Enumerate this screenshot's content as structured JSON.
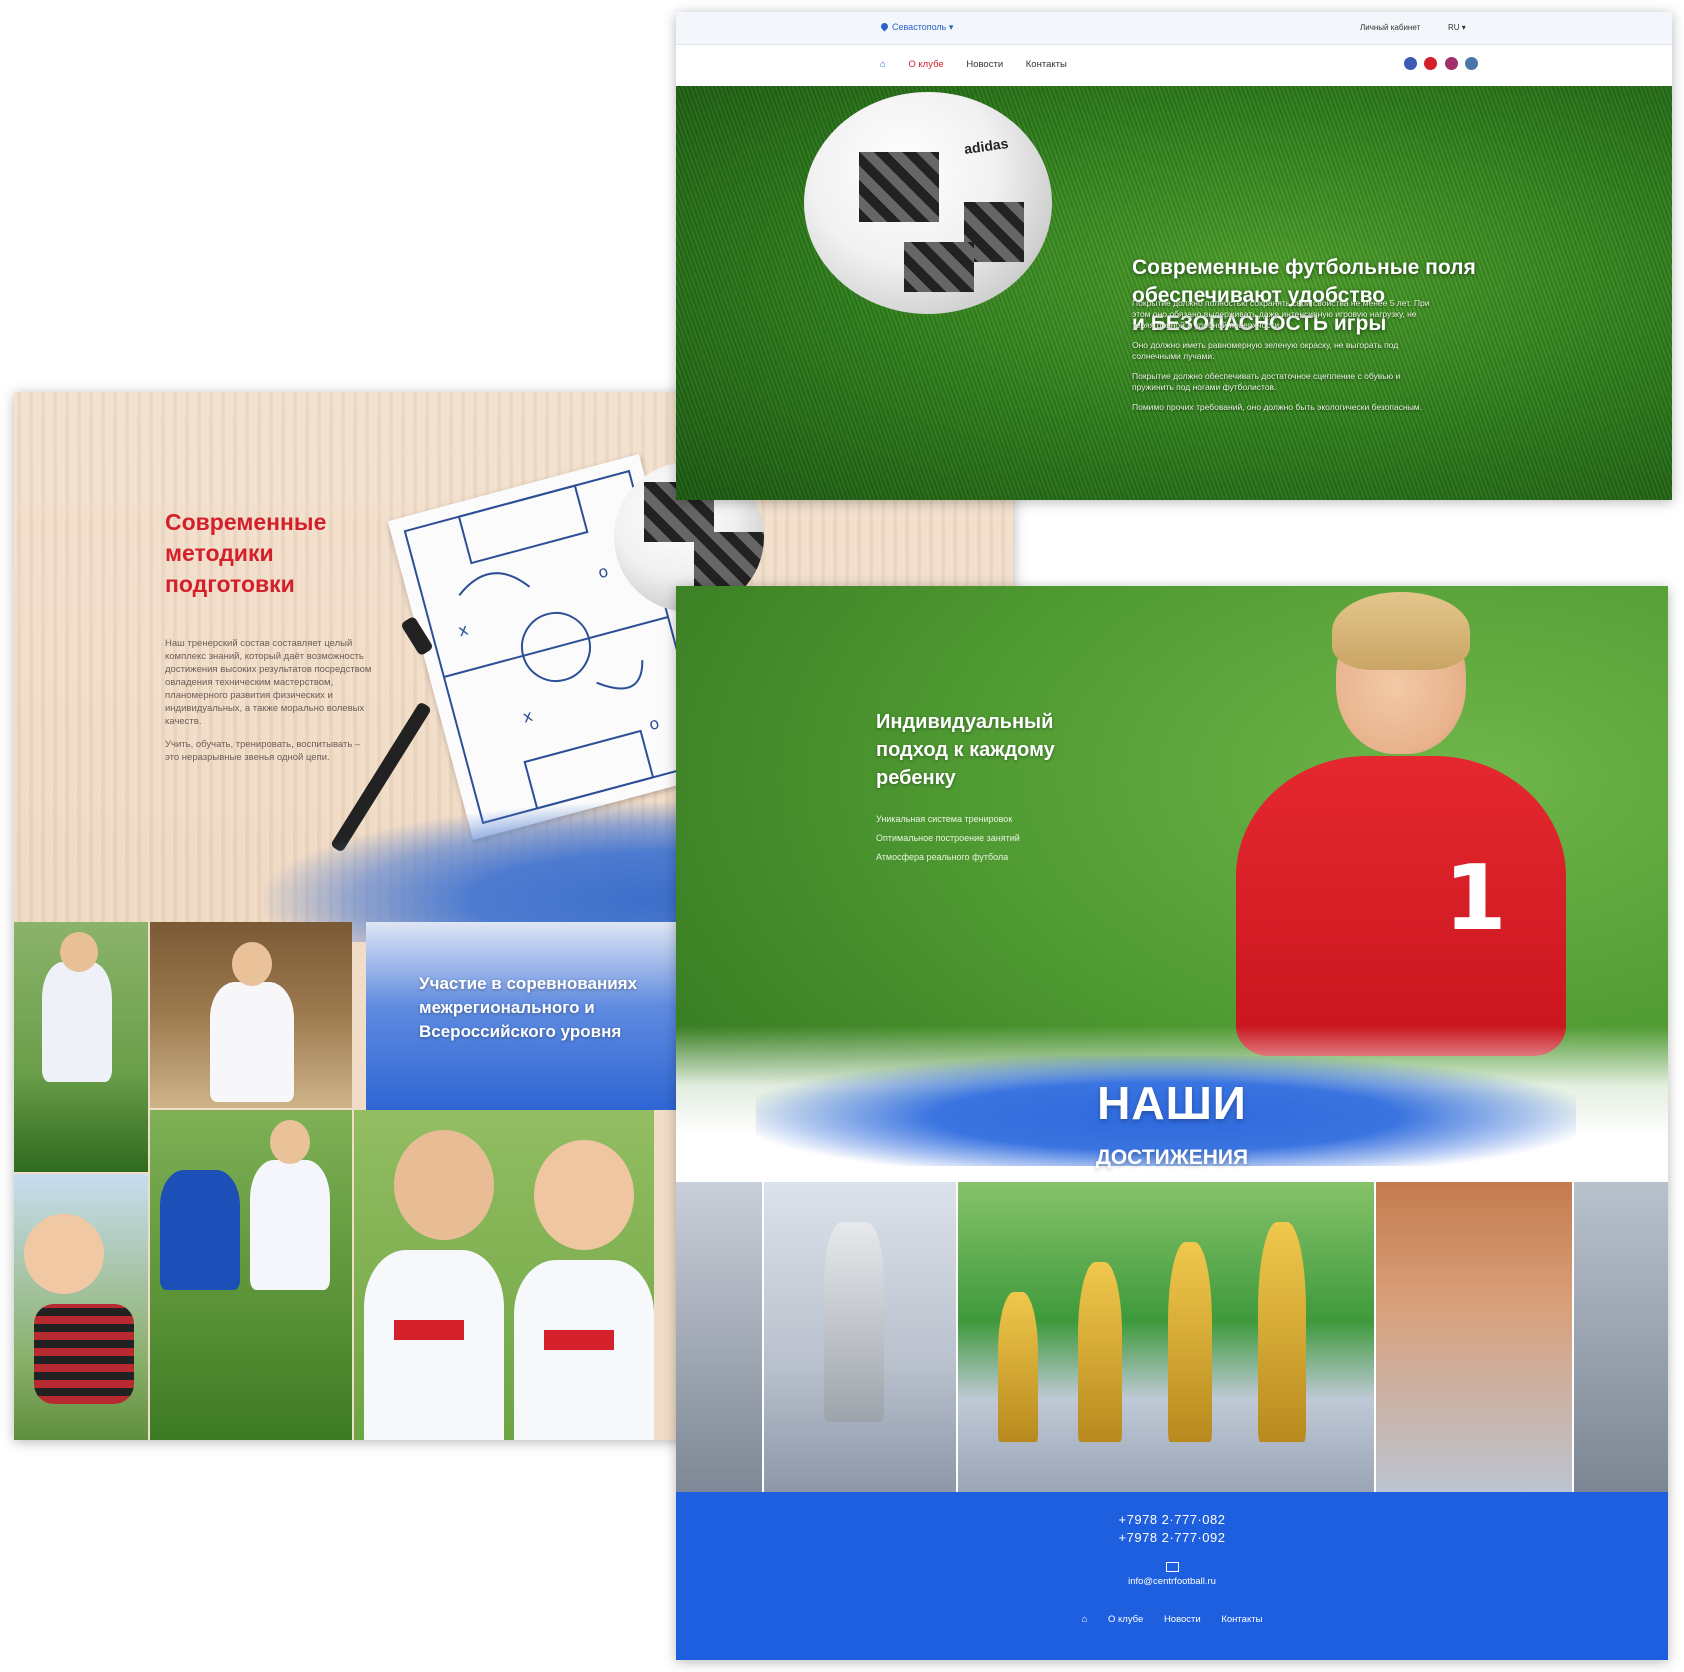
{
  "header": {
    "city": "Севастополь",
    "cabinet": "Личный кабинет",
    "lang": "RU",
    "nav": [
      "О клубе",
      "Новости",
      "Контакты"
    ],
    "social_icons": [
      "facebook-icon",
      "youtube-icon",
      "instagram-icon",
      "vk-icon"
    ]
  },
  "hero": {
    "title_lines": [
      "Современные футбольные поля",
      "обеспечивают  удобство",
      "и БЕЗОПАСНОСТЬ игры"
    ],
    "paragraphs": [
      "Покрытие должно полностью сохранять свои свойства не менее 5 лет. При этом оно обязано выдерживать даже интенсивную игровую нагрузку, не теряя ровной и удобной поверхности.",
      "Оно должно иметь равномерную зеленую окраску, не выгорать под солнечными лучами.",
      "Покрытие должно обеспечивать достаточное сцепление с обувью и пружинить под ногами футболистов.",
      "Помимо прочих требований, оно должно быть экологически безопасным."
    ],
    "ball_brand": "adidas"
  },
  "methods": {
    "title_lines": [
      "Современные",
      "методики",
      "подготовки"
    ],
    "paragraphs": [
      "Наш тренерский состав составляет целый комплекс знаний, который даёт возможность достижения высоких результатов посредством овладения техническим мастерством, планомерного развития физических и индивидуальных, а также морально волевых качеств.",
      "Учить, обучать, тренировать, воспитывать – это неразрывные звенья одной цепи."
    ]
  },
  "competition": {
    "title_lines": [
      "Участие в соревнованиях",
      "межрегионального и",
      "Всероссийского уровня"
    ]
  },
  "individual": {
    "title_lines": [
      "Индивидуальный",
      "подход к каждому",
      "ребенку"
    ],
    "items": [
      "Уникальная система тренировок",
      "Оптимальное построение занятий",
      "Атмосфера реального футбола"
    ],
    "jersey_number": "1"
  },
  "achievements": {
    "line1": "НАШИ",
    "line2": "ДОСТИЖЕНИЯ"
  },
  "footer": {
    "phones": [
      "+7978 2·777·082",
      "+7978 2·777·092"
    ],
    "email": "info@centrfootball.ru",
    "nav": [
      "О клубе",
      "Новости",
      "Контакты"
    ]
  },
  "colors": {
    "accent_red": "#d4202a",
    "brand_blue": "#1e5fe0",
    "grass_green": "#2f7f1c"
  }
}
